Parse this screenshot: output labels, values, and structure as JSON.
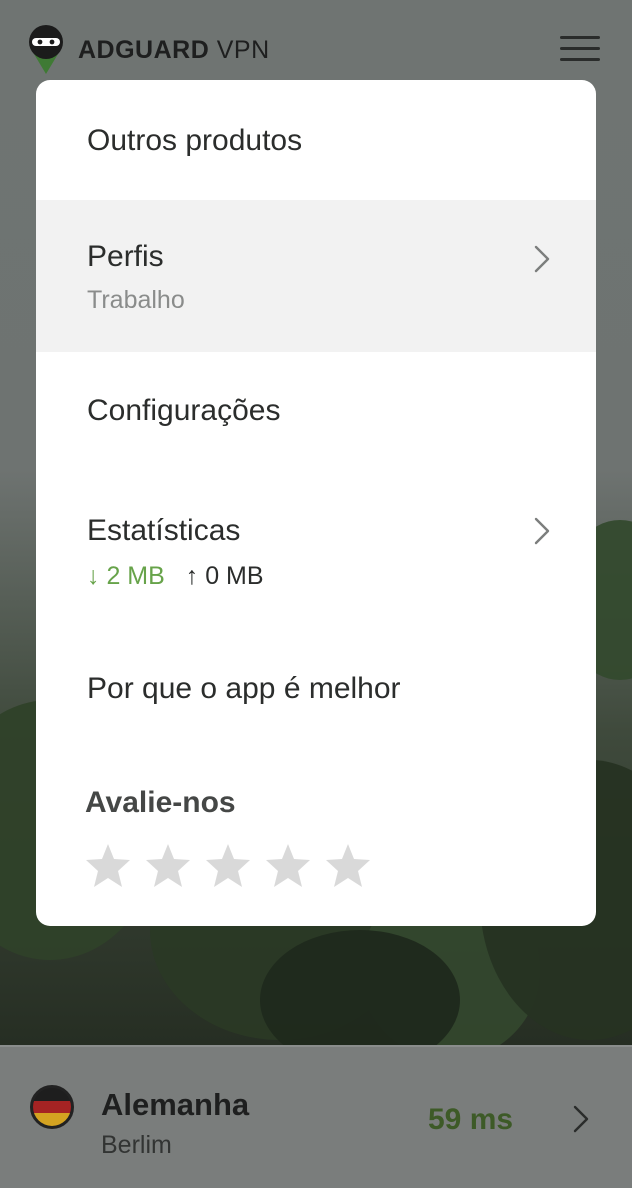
{
  "header": {
    "brand_bold": "ADGUARD",
    "brand_light": "VPN",
    "logo_icon": "adguard-ninja-logo",
    "menu_icon": "hamburger-menu-icon"
  },
  "menu": {
    "items": [
      {
        "label": "Outros produtos"
      },
      {
        "label": "Perfis",
        "sub": "Trabalho",
        "icon": "chevron-right-icon"
      },
      {
        "label": "Configurações"
      },
      {
        "label": "Estatísticas",
        "download": "↓ 2 MB",
        "upload": "↑ 0 MB",
        "icon": "chevron-right-icon"
      },
      {
        "label": "Por que o app é melhor"
      }
    ],
    "rate": {
      "label": "Avalie-nos",
      "stars_total": 5,
      "stars_filled": 0
    }
  },
  "location": {
    "country": "Alemanha",
    "city": "Berlim",
    "ping": "59 ms",
    "flag_icon": "germany-flag-icon"
  },
  "colors": {
    "accent_green": "#67a34a",
    "ping_green": "#3d5a27",
    "menu_active_bg": "#f2f2f2",
    "star_gray": "#d9d9d9"
  }
}
